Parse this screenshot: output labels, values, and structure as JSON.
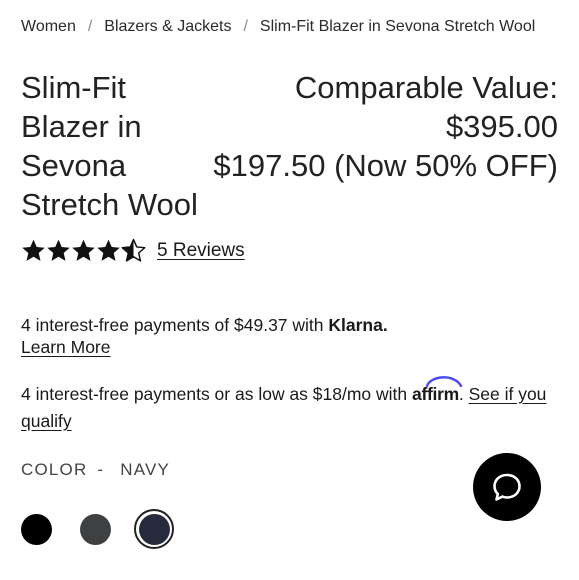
{
  "breadcrumb": {
    "items": [
      "Women",
      "Blazers & Jackets",
      "Slim-Fit Blazer in Sevona Stretch Wool"
    ],
    "separator": "/"
  },
  "product": {
    "title": "Slim-Fit Blazer in Sevona Stretch Wool",
    "comparable_label": "Comparable Value:",
    "comparable_price": "$395.00",
    "sale_price": "$197.50 (Now 50% OFF)"
  },
  "rating": {
    "stars": 4.5,
    "out_of": 5,
    "reviews_text": "5 Reviews"
  },
  "klarna": {
    "text": "4 interest-free payments of $49.37 with ",
    "brand": "Klarna.",
    "link": "Learn More"
  },
  "affirm": {
    "text": "4 interest-free payments or as low as $18/mo with ",
    "brand": "affirm",
    "after": ". ",
    "link": "See if you qualify"
  },
  "color": {
    "label": "COLOR",
    "separator": "-",
    "selected": "NAVY",
    "swatches": [
      {
        "name": "black",
        "hex": "#000000"
      },
      {
        "name": "charcoal",
        "hex": "#3f4042"
      },
      {
        "name": "navy",
        "hex": "#262a3d",
        "selected": true
      }
    ]
  },
  "colors": {
    "text": "#1a1a1a",
    "affirm_arc": "#4a4af4",
    "chat_button": "#000000"
  },
  "icons": {
    "chat": "chat-bubble-icon",
    "star_full": "star-filled-icon",
    "star_half": "star-half-icon"
  }
}
